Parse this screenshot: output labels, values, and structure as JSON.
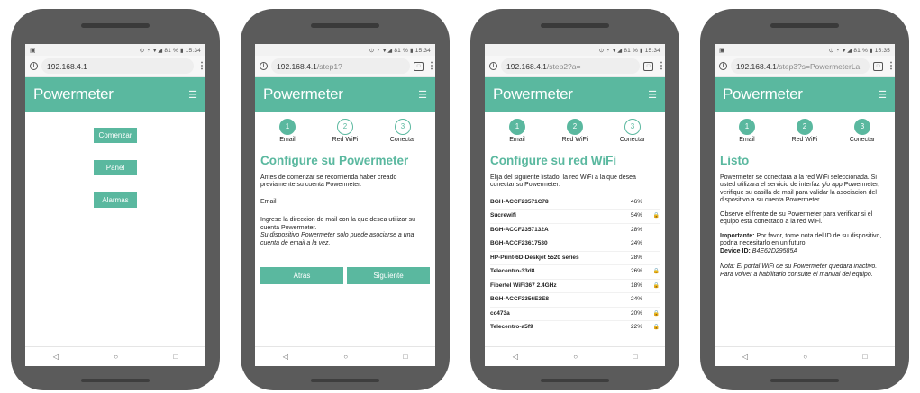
{
  "common": {
    "brand": "Powermeter",
    "hamburger_glyph": "☰",
    "menu_glyph": "⋮",
    "tabs_count": "□",
    "info_glyph": "i",
    "nav": {
      "back": "◁",
      "home": "○",
      "recent": "□"
    },
    "steps": [
      {
        "number": "1",
        "label": "Email"
      },
      {
        "number": "2",
        "label": "Red WiFi"
      },
      {
        "number": "3",
        "label": "Conectar"
      }
    ],
    "colors": {
      "accent": "#5ab89f",
      "phone_body": "#5b5b5b"
    }
  },
  "phones": [
    {
      "status_left": "▣",
      "status_right": "⊙ ◔ ▼◢ 81 % ▮ 15:34",
      "url_host": "192.168.4.1",
      "url_path": "",
      "buttons": [
        "Comenzar",
        "Panel",
        "Alarmas"
      ]
    },
    {
      "status_left": "",
      "status_right": "⊙ ◔ ▼◢ 81 % ▮ 15:34",
      "url_host": "192.168.4.1",
      "url_path": "/step1?",
      "title": "Configure su Powermeter",
      "intro": "Antes de comenzar se recomienda haber creado previamente su cuenta Powermeter.",
      "field_label": "Email",
      "help": "Ingrese la direccion de mail con la que desea utilizar su cuenta Powermeter.",
      "help_italic": "Su dispositivo Powermeter solo puede asociarse a una cuenta de email a la vez.",
      "back_label": "Atras",
      "next_label": "Siguiente"
    },
    {
      "status_left": "",
      "status_right": "⊙ ◔ ▼◢ 81 % ▮ 15:34",
      "url_host": "192.168.4.1",
      "url_path": "/step2?a=",
      "title": "Configure su red WiFi",
      "intro": "Elija del siguiente listado, la red WiFi a la que desea conectar su Powermeter:",
      "networks": [
        {
          "ssid": "BGH-ACCF23571C78",
          "signal": "46%",
          "locked": ""
        },
        {
          "ssid": "Sucrewifi",
          "signal": "54%",
          "locked": "🔒"
        },
        {
          "ssid": "BGH-ACCF2357132A",
          "signal": "28%",
          "locked": ""
        },
        {
          "ssid": "BGH-ACCF23617530",
          "signal": "24%",
          "locked": ""
        },
        {
          "ssid": "HP-Print-6D-Deskjet 5520 series",
          "signal": "28%",
          "locked": ""
        },
        {
          "ssid": "Telecentro-33d8",
          "signal": "26%",
          "locked": "🔒"
        },
        {
          "ssid": "Fibertel WiFi367 2.4GHz",
          "signal": "18%",
          "locked": "🔒"
        },
        {
          "ssid": "BGH-ACCF2356E3E8",
          "signal": "24%",
          "locked": ""
        },
        {
          "ssid": "cc473a",
          "signal": "20%",
          "locked": "🔒"
        },
        {
          "ssid": "Telecentro-a5f9",
          "signal": "22%",
          "locked": "🔒"
        }
      ]
    },
    {
      "status_left": "▣",
      "status_right": "⊙ ◔ ▼◢ 81 % ▮ 15:35",
      "url_host": "192.168.4.1",
      "url_path": "/step3?s=PowermeterLa",
      "title": "Listo",
      "p1": "Powermeter se conectara a la red WiFi seleccionada. Si usted utilizara el servicio de interfaz y/o app Powermeter, verifique su casilla de mail para validar la asociacion del dispositivo a su cuenta Powermeter.",
      "p2": "Observe el frente de su Powermeter para verificar si el equipo esta conectado a la red WiFi.",
      "important_label": "Importante:",
      "important_text": " Por favor, tome nota del ID de su dispositivo, podria necesitarlo en un futuro.",
      "device_id_label": "Device ID:",
      "device_id_value": " B4E62D29585A",
      "note": "Nota: El portal WiFi de su Powermeter quedara inactivo. Para volver a habilitarlo consulte el manual del equipo."
    }
  ]
}
